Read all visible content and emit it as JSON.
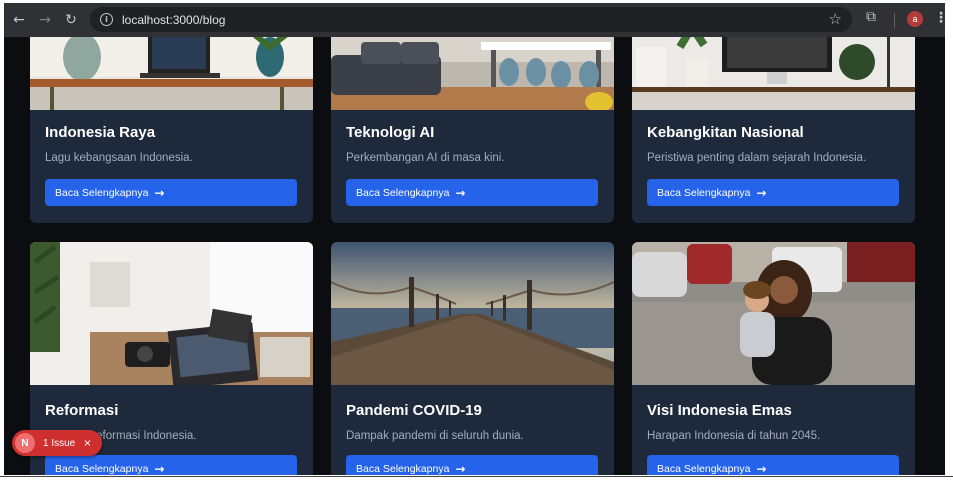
{
  "browser": {
    "url": "localhost:3000/blog",
    "profile_initial": "a",
    "back_icon": "arrow-left",
    "forward_icon": "arrow-right",
    "reload_icon": "reload",
    "info_icon": "info",
    "star_icon": "star",
    "extensions_icon": "puzzle",
    "menu_icon": "vertical-dots"
  },
  "colors": {
    "page_bg": "#0c0d10",
    "card_bg": "#1e293b",
    "button_bg": "#2563eb",
    "issue_badge": "#cf2f2f"
  },
  "cards": [
    {
      "title": "Indonesia Raya",
      "description": "Lagu kebangsaan Indonesia.",
      "button": "Baca Selengkapnya"
    },
    {
      "title": "Teknologi AI",
      "description": "Perkembangan AI di masa kini.",
      "button": "Baca Selengkapnya"
    },
    {
      "title": "Kebangkitan Nasional",
      "description": "Peristiwa penting dalam sejarah Indonesia.",
      "button": "Baca Selengkapnya"
    },
    {
      "title": "Reformasi",
      "description": "Gerakan reformasi Indonesia.",
      "button": "Baca Selengkapnya"
    },
    {
      "title": "Pandemi COVID-19",
      "description": "Dampak pandemi di seluruh dunia.",
      "button": "Baca Selengkapnya"
    },
    {
      "title": "Visi Indonesia Emas",
      "description": "Harapan Indonesia di tahun 2045.",
      "button": "Baca Selengkapnya"
    }
  ],
  "issue_badge": {
    "logo": "N",
    "text": "1 Issue",
    "close": "×"
  }
}
